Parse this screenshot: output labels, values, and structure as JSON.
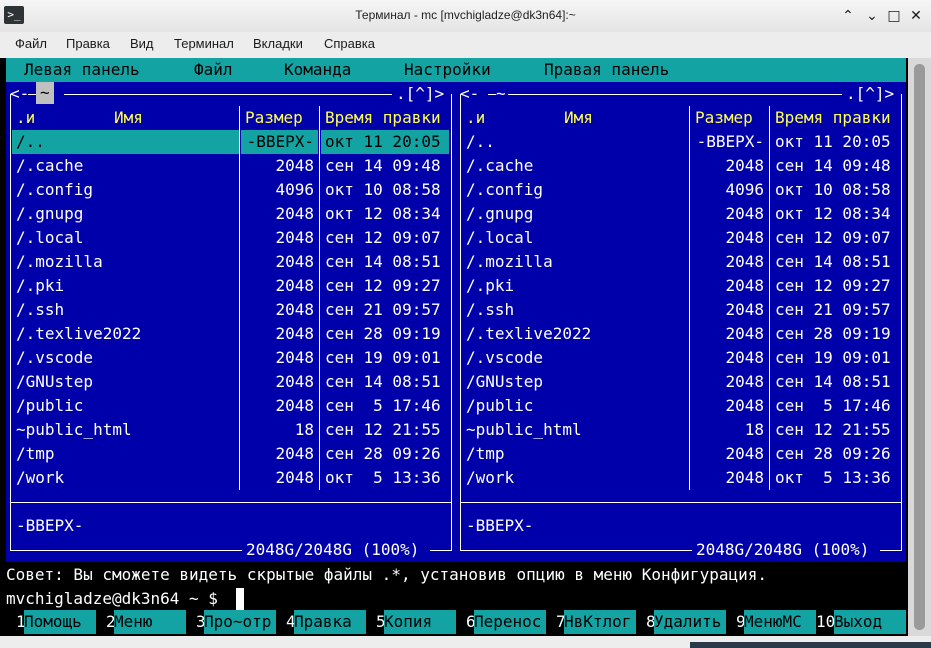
{
  "window": {
    "title": "Терминал - mc [mvchigladze@dk3n64]:~",
    "icon_glyph": ">_",
    "minimize_glyph": "⌃",
    "restore_glyph": "⌄",
    "maximize_glyph": "□",
    "close_glyph": "✕"
  },
  "menubar": [
    "Файл",
    "Правка",
    "Вид",
    "Терминал",
    "Вкладки",
    "Справка"
  ],
  "mc_menu": [
    "Левая панель",
    "Файл",
    "Команда",
    "Настройки",
    "Правая панель"
  ],
  "left_panel": {
    "path": "~",
    "indicator": ".[^]>",
    "corner": "<-",
    "headers": [
      ".и",
      "Имя",
      "Размер",
      "Время правки"
    ],
    "rows": [
      {
        "name": "/..",
        "size": "-ВВЕРХ-",
        "time": "окт 11 20:05"
      },
      {
        "name": "/.cache",
        "size": "2048",
        "time": "сен 14 09:48"
      },
      {
        "name": "/.config",
        "size": "4096",
        "time": "окт 10 08:58"
      },
      {
        "name": "/.gnupg",
        "size": "2048",
        "time": "окт 12 08:34"
      },
      {
        "name": "/.local",
        "size": "2048",
        "time": "сен 12 09:07"
      },
      {
        "name": "/.mozilla",
        "size": "2048",
        "time": "сен 14 08:51"
      },
      {
        "name": "/.pki",
        "size": "2048",
        "time": "сен 12 09:27"
      },
      {
        "name": "/.ssh",
        "size": "2048",
        "time": "сен 21 09:57"
      },
      {
        "name": "/.texlive2022",
        "size": "2048",
        "time": "сен 28 09:19"
      },
      {
        "name": "/.vscode",
        "size": "2048",
        "time": "сен 19 09:01"
      },
      {
        "name": "/GNUstep",
        "size": "2048",
        "time": "сен 14 08:51"
      },
      {
        "name": "/public",
        "size": "2048",
        "time": "сен  5 17:46"
      },
      {
        "name": "~public_html",
        "size": "18",
        "time": "сен 12 21:55"
      },
      {
        "name": "/tmp",
        "size": "2048",
        "time": "сен 28 09:26"
      },
      {
        "name": "/work",
        "size": "2048",
        "time": "окт  5 13:36"
      }
    ],
    "status": "-ВВЕРХ-",
    "disk": "2048G/2048G (100%)"
  },
  "right_panel": {
    "path": "~",
    "indicator": ".[^]>",
    "corner": "<-",
    "headers": [
      ".и",
      "Имя",
      "Размер",
      "Время правки"
    ],
    "rows": [
      {
        "name": "/..",
        "size": "-ВВЕРХ-",
        "time": "окт 11 20:05"
      },
      {
        "name": "/.cache",
        "size": "2048",
        "time": "сен 14 09:48"
      },
      {
        "name": "/.config",
        "size": "4096",
        "time": "окт 10 08:58"
      },
      {
        "name": "/.gnupg",
        "size": "2048",
        "time": "окт 12 08:34"
      },
      {
        "name": "/.local",
        "size": "2048",
        "time": "сен 12 09:07"
      },
      {
        "name": "/.mozilla",
        "size": "2048",
        "time": "сен 14 08:51"
      },
      {
        "name": "/.pki",
        "size": "2048",
        "time": "сен 12 09:27"
      },
      {
        "name": "/.ssh",
        "size": "2048",
        "time": "сен 21 09:57"
      },
      {
        "name": "/.texlive2022",
        "size": "2048",
        "time": "сен 28 09:19"
      },
      {
        "name": "/.vscode",
        "size": "2048",
        "time": "сен 19 09:01"
      },
      {
        "name": "/GNUstep",
        "size": "2048",
        "time": "сен 14 08:51"
      },
      {
        "name": "/public",
        "size": "2048",
        "time": "сен  5 17:46"
      },
      {
        "name": "~public_html",
        "size": "18",
        "time": "сен 12 21:55"
      },
      {
        "name": "/tmp",
        "size": "2048",
        "time": "сен 28 09:26"
      },
      {
        "name": "/work",
        "size": "2048",
        "time": "окт  5 13:36"
      }
    ],
    "status": "-ВВЕРХ-",
    "disk": "2048G/2048G (100%)"
  },
  "hint": "Совет: Вы сможете видеть скрытые файлы .*, установив опцию в меню Конфигурация.",
  "prompt": "mvchigladze@dk3n64 ~ $",
  "fkeys": [
    {
      "num": "1",
      "label": "Помощь"
    },
    {
      "num": "2",
      "label": "Меню"
    },
    {
      "num": "3",
      "label": "Про~отр"
    },
    {
      "num": "4",
      "label": "Правка"
    },
    {
      "num": "5",
      "label": "Копия"
    },
    {
      "num": "6",
      "label": "Перенос"
    },
    {
      "num": "7",
      "label": "НвКтлог"
    },
    {
      "num": "8",
      "label": "Удалить"
    },
    {
      "num": "9",
      "label": "МенюMC"
    },
    {
      "num": "10",
      "label": "Выход"
    }
  ],
  "colors": {
    "panel_bg": "#0000aa",
    "accent_cyan": "#14a3a3",
    "header_yellow": "#ffff55",
    "terminal_bg": "#000000"
  }
}
